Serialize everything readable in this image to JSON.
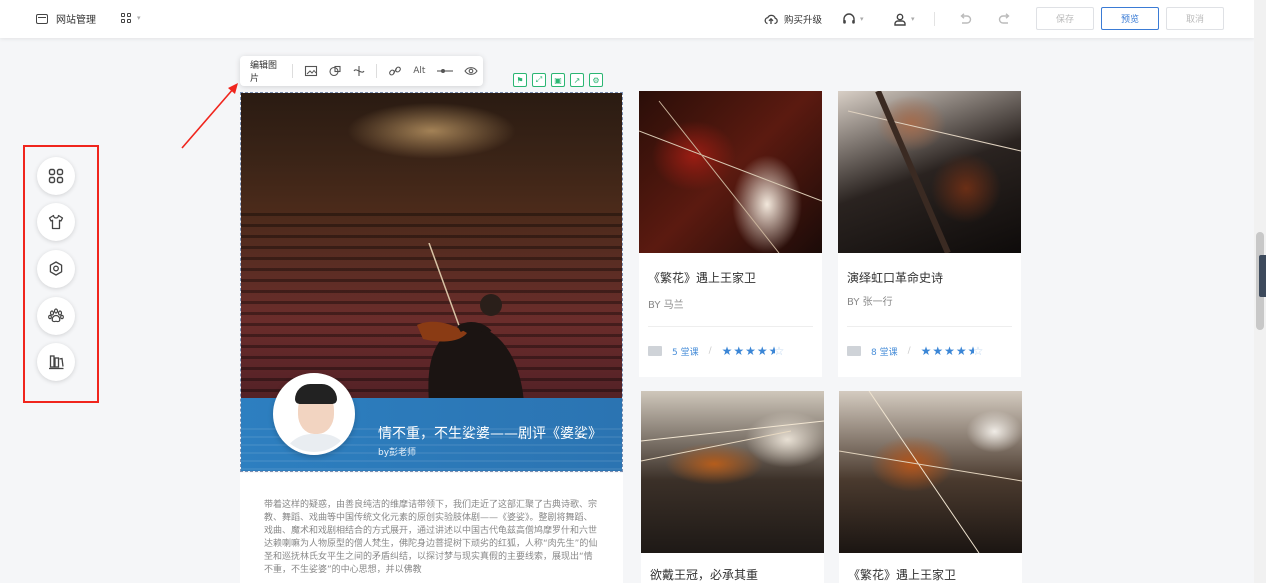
{
  "topbar": {
    "site_manage": "网站管理",
    "buy_upgrade": "购买升级",
    "save": "保存",
    "preview": "预览",
    "cancel": "取消"
  },
  "edit_toolbar": {
    "edit_image": "编辑图片",
    "alt": "Alt"
  },
  "rail": {
    "items": [
      "components-icon",
      "shirt-icon",
      "settings-icon",
      "paw-icon",
      "library-icon"
    ]
  },
  "hero": {
    "title": "情不重，不生娑婆——剧评《婆娑》",
    "by": "by彭老师"
  },
  "article": {
    "text": "带着这样的疑惑，由善良纯洁的维摩诘带领下，我们走近了这部汇聚了古典诗歌、宗教、舞蹈、戏曲等中国传统文化元素的原创实验肢体剧——《婆娑》。整剧将舞蹈、戏曲、魔术和戏剧相结合的方式展开，通过讲述以中国古代龟兹高僧鸠摩罗什和六世达赖喇嘛为人物原型的僧人梵生，佛陀身边菩提树下顽劣的红狐，人称“肉先生”的仙圣和巡抚林氏女平生之间的矛盾纠结，以探讨梦与现实真假的主要线索，展现出“情不重，不生娑婆”的中心思想，并以佛教"
  },
  "cards": [
    {
      "title": "《繁花》遇上王家卫",
      "by": "BY 马兰",
      "lessons": "5 堂课",
      "rating": 4.5
    },
    {
      "title": "演绎虹口革命史诗",
      "by": "BY 张一行",
      "lessons": "8 堂课",
      "rating": 4.5
    },
    {
      "title": "欲戴王冠，必承其重",
      "by": "",
      "lessons": "",
      "rating": null
    },
    {
      "title": "《繁花》遇上王家卫",
      "by": "",
      "lessons": "",
      "rating": null
    }
  ],
  "colors": {
    "accent": "#3a7bd5",
    "highlight_red": "#f0251d",
    "tool_green": "#2bb673",
    "star_blue": "#3b86d6"
  }
}
